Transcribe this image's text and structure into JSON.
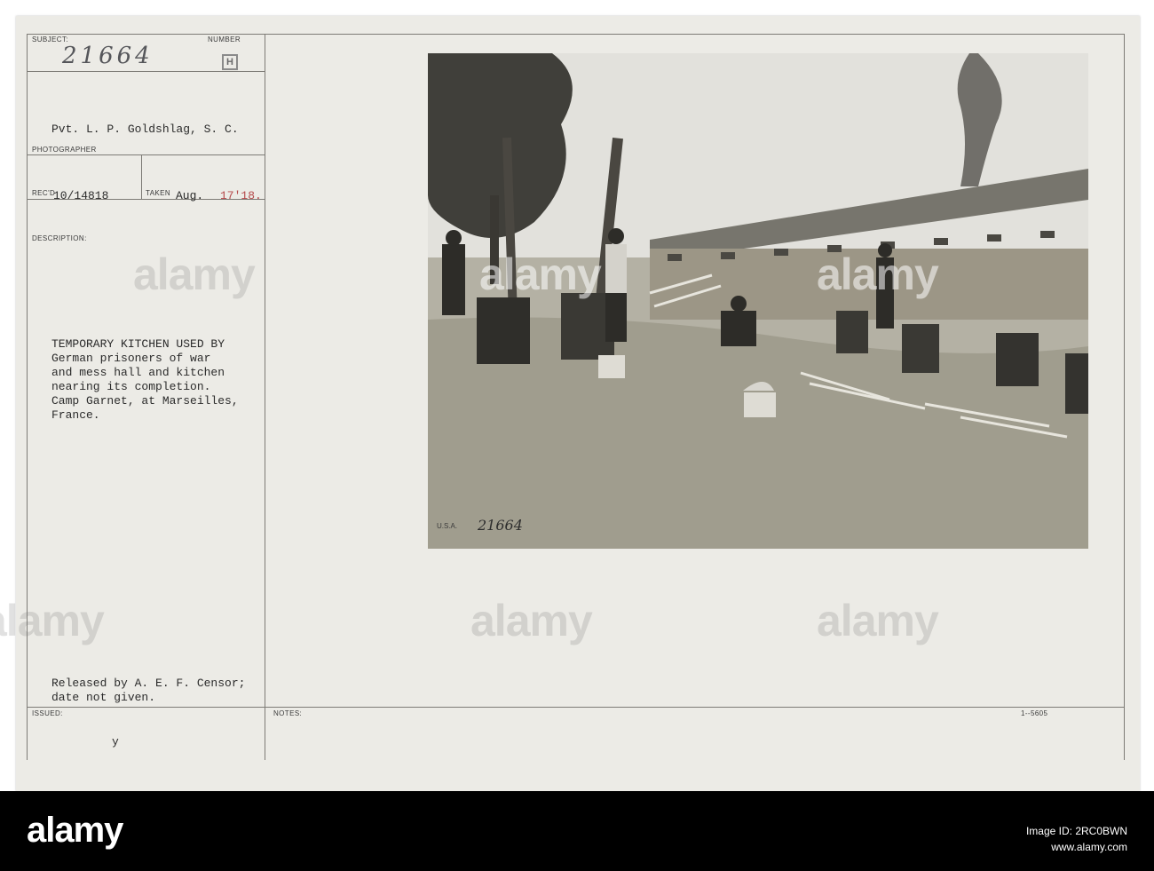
{
  "card": {
    "labels": {
      "subject": "SUBJECT:",
      "number": "NUMBER",
      "photographer": "PHOTOGRAPHER",
      "received": "REC'D",
      "taken": "TAKEN",
      "description": "DESCRIPTION:",
      "issued": "ISSUED:",
      "notes": "NOTES:"
    },
    "subject_number": "21664",
    "number_stamp": "H",
    "photographer": "Pvt. L. P. Goldshlag, S. C.",
    "received_value": "10/14818",
    "taken_value_date": "Aug.",
    "taken_value_year": "17'18.",
    "description_lines": [
      "TEMPORARY KITCHEN USED BY",
      "German prisoners of war",
      "and mess hall and kitchen",
      "nearing its completion.",
      "Camp Garnet, at Marseilles,",
      "France."
    ],
    "release_lines": [
      "Released by A. E. F. Censor;",
      "date not given."
    ],
    "issued_value": "y",
    "form_number": "1--5605",
    "photo_caption_number": "21664",
    "photo_stamp_text": "U.S.A."
  },
  "watermark": "alamy",
  "footer": {
    "logo": "alamy",
    "image_id_label": "Image ID: 2RC0BWN",
    "url": "www.alamy.com"
  }
}
